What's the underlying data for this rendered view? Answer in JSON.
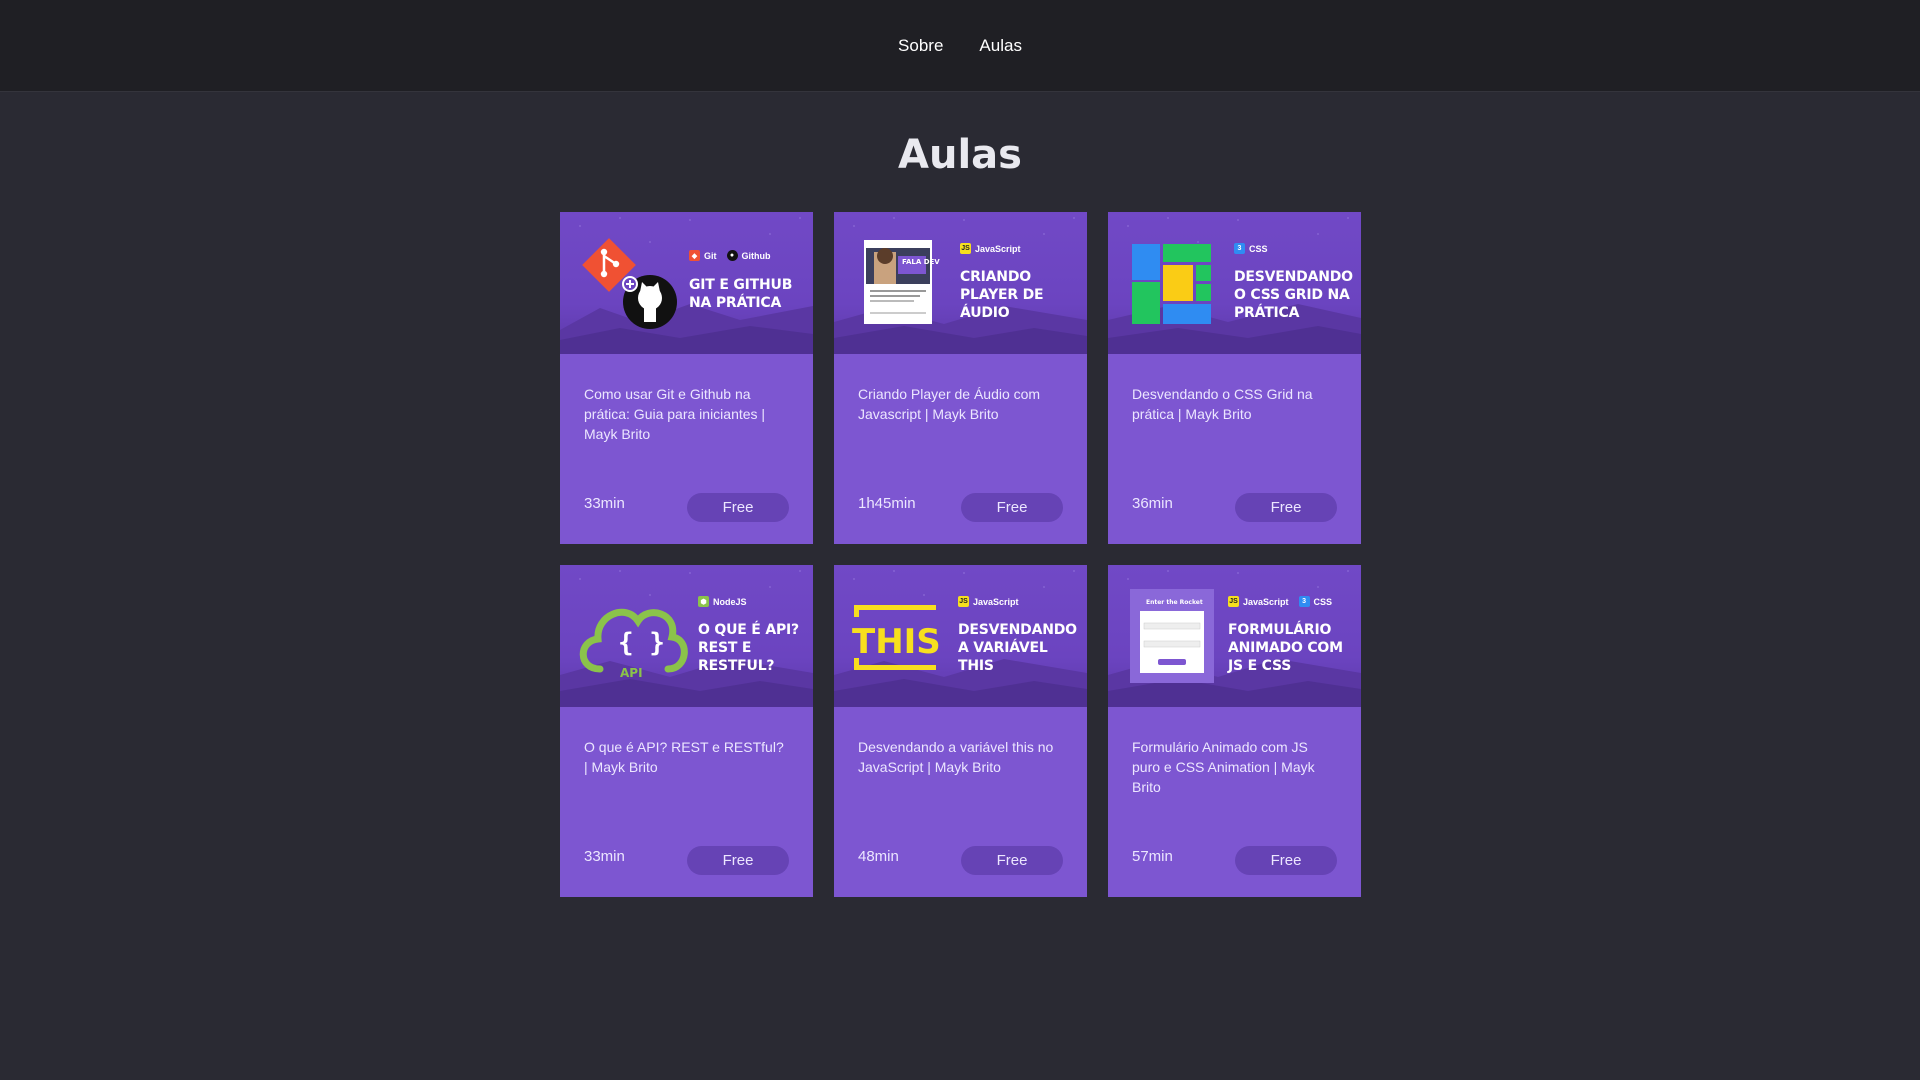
{
  "nav": {
    "about": "Sobre",
    "lessons": "Aulas"
  },
  "page_title": "Aulas",
  "colors": {
    "card": "#7d56d1",
    "button": "#6643b5",
    "background": "#2a2a33",
    "header": "#1f1f24"
  },
  "cards": [
    {
      "tags": [
        {
          "icon": "git-icon",
          "label": "Git"
        },
        {
          "icon": "github-icon",
          "label": "Github"
        }
      ],
      "thumb_title": "Git e Github na prática",
      "description": "Como usar Git e Github na prática: Guia para iniciantes | Mayk Brito",
      "duration": "33min",
      "button": "Free"
    },
    {
      "tags": [
        {
          "icon": "javascript-icon",
          "label": "JavaScript"
        }
      ],
      "thumb_title": "Criando player de áudio",
      "thumb_extra": "FALA DEV",
      "description": "Criando Player de Áudio com Javascript | Mayk Brito",
      "duration": "1h45min",
      "button": "Free"
    },
    {
      "tags": [
        {
          "icon": "css-icon",
          "label": "CSS"
        }
      ],
      "thumb_title": "Desvendando o CSS Grid na prática",
      "description": "Desvendando o CSS Grid na prática | Mayk Brito",
      "duration": "36min",
      "button": "Free"
    },
    {
      "tags": [
        {
          "icon": "nodejs-icon",
          "label": "NodeJS"
        }
      ],
      "thumb_title": "O que é API? REST e RESTful?",
      "thumb_extra": "API",
      "description": "O que é API? REST e RESTful? | Mayk Brito",
      "duration": "33min",
      "button": "Free"
    },
    {
      "tags": [
        {
          "icon": "javascript-icon",
          "label": "JavaScript"
        }
      ],
      "thumb_title": "Desvendando a variável this",
      "thumb_extra": "THIS",
      "description": "Desvendando a variável this no JavaScript | Mayk Brito",
      "duration": "48min",
      "button": "Free"
    },
    {
      "tags": [
        {
          "icon": "javascript-icon",
          "label": "JavaScript"
        },
        {
          "icon": "css-icon",
          "label": "CSS"
        }
      ],
      "thumb_title": "Formulário animado com JS e CSS",
      "thumb_extra": "Enter the Rocket",
      "description": "Formulário Animado com JS puro e CSS Animation | Mayk Brito",
      "duration": "57min",
      "button": "Free"
    }
  ]
}
